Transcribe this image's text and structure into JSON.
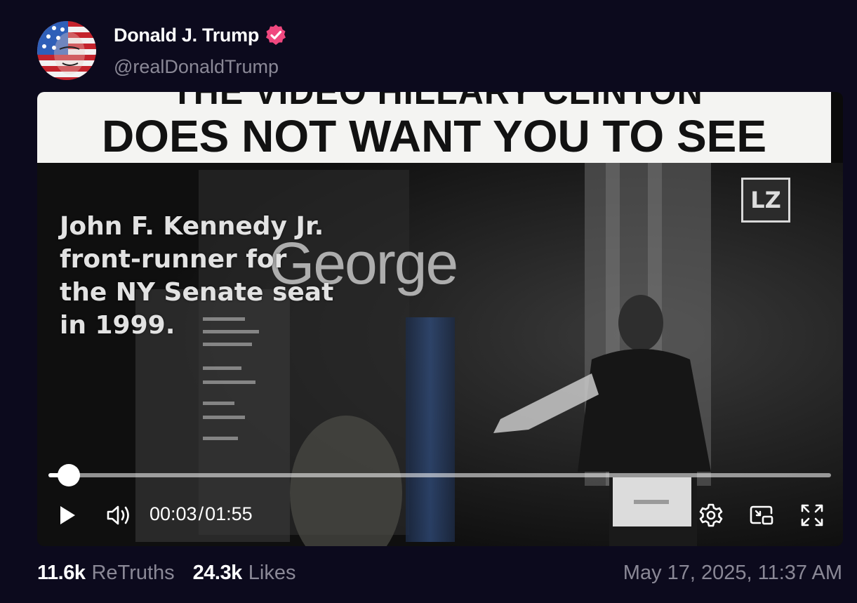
{
  "post": {
    "author_name": "Donald J. Trump",
    "author_handle": "@realDonaldTrump",
    "verified": true,
    "verified_color": "#f0487f",
    "avatar_icon": "american-flag-face-portrait"
  },
  "video": {
    "banner_line1": "THE VIDEO HILLARY CLINTON",
    "banner_line2": "DOES NOT WANT YOU TO SEE",
    "overlay_caption": "John F. Kennedy Jr.\nfront-runner for\nthe NY Senate seat\nin 1999.",
    "backdrop_logo": "George",
    "watermark": "LZ",
    "current_time": "00:03",
    "separator": "/",
    "duration": "01:55",
    "progress_fraction": 0.026,
    "controls": {
      "play_icon": "play-icon",
      "volume_icon": "volume-icon",
      "settings_icon": "gear-icon",
      "pip_icon": "picture-in-picture-icon",
      "fullscreen_icon": "fullscreen-icon"
    }
  },
  "stats": {
    "retruths_count": "11.6k",
    "retruths_label": "ReTruths",
    "likes_count": "24.3k",
    "likes_label": "Likes",
    "timestamp": "May 17, 2025, 11:37 AM"
  },
  "colors": {
    "background": "#0c0a1d",
    "muted_text": "#8a8896"
  }
}
